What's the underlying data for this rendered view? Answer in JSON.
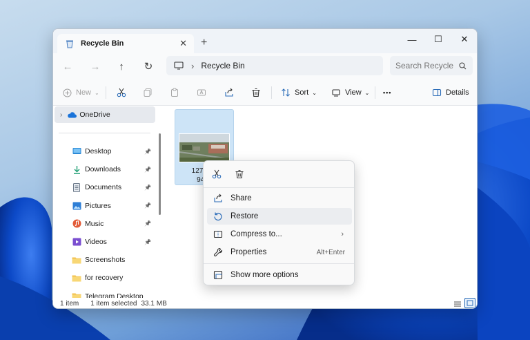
{
  "tab": {
    "title": "Recycle Bin",
    "close": "✕",
    "new_tab": "+"
  },
  "window_controls": {
    "minimize": "—",
    "maximize": "☐",
    "close": "✕"
  },
  "nav": {
    "back": "←",
    "forward": "→",
    "up": "↑",
    "refresh": "↻"
  },
  "address": {
    "location": "Recycle Bin",
    "separator": "›"
  },
  "search": {
    "placeholder": "Search Recycle"
  },
  "toolbar": {
    "new_label": "New",
    "sort_label": "Sort",
    "view_label": "View",
    "more_label": "•••",
    "details_label": "Details"
  },
  "sidebar": {
    "onedrive": "OneDrive",
    "items": [
      {
        "label": "Desktop",
        "icon": "desktop-icon",
        "color": "#2b8ad6"
      },
      {
        "label": "Downloads",
        "icon": "download-icon",
        "color": "#1f9e73"
      },
      {
        "label": "Documents",
        "icon": "document-icon",
        "color": "#6e7b8b"
      },
      {
        "label": "Pictures",
        "icon": "pictures-icon",
        "color": "#2f7fd6"
      },
      {
        "label": "Music",
        "icon": "music-icon",
        "color": "#e35d3a"
      },
      {
        "label": "Videos",
        "icon": "videos-icon",
        "color": "#7b4fd0"
      },
      {
        "label": "Screenshots",
        "icon": "folder-icon",
        "color": "#f2c14e"
      },
      {
        "label": "for recovery",
        "icon": "folder-icon",
        "color": "#f2c14e"
      },
      {
        "label": "Telegram Desktop",
        "icon": "folder-icon",
        "color": "#f2c14e"
      }
    ]
  },
  "file": {
    "name_line1": "127181-",
    "name_line2": "94_s"
  },
  "status": {
    "count": "1 item",
    "selection": "1 item selected",
    "size": "33.1 MB"
  },
  "context_menu": {
    "share": "Share",
    "restore": "Restore",
    "compress": "Compress to...",
    "properties": "Properties",
    "properties_shortcut": "Alt+Enter",
    "more_options": "Show more options"
  },
  "colors": {
    "accent": "#0067c0",
    "selection": "#cde4f7"
  }
}
